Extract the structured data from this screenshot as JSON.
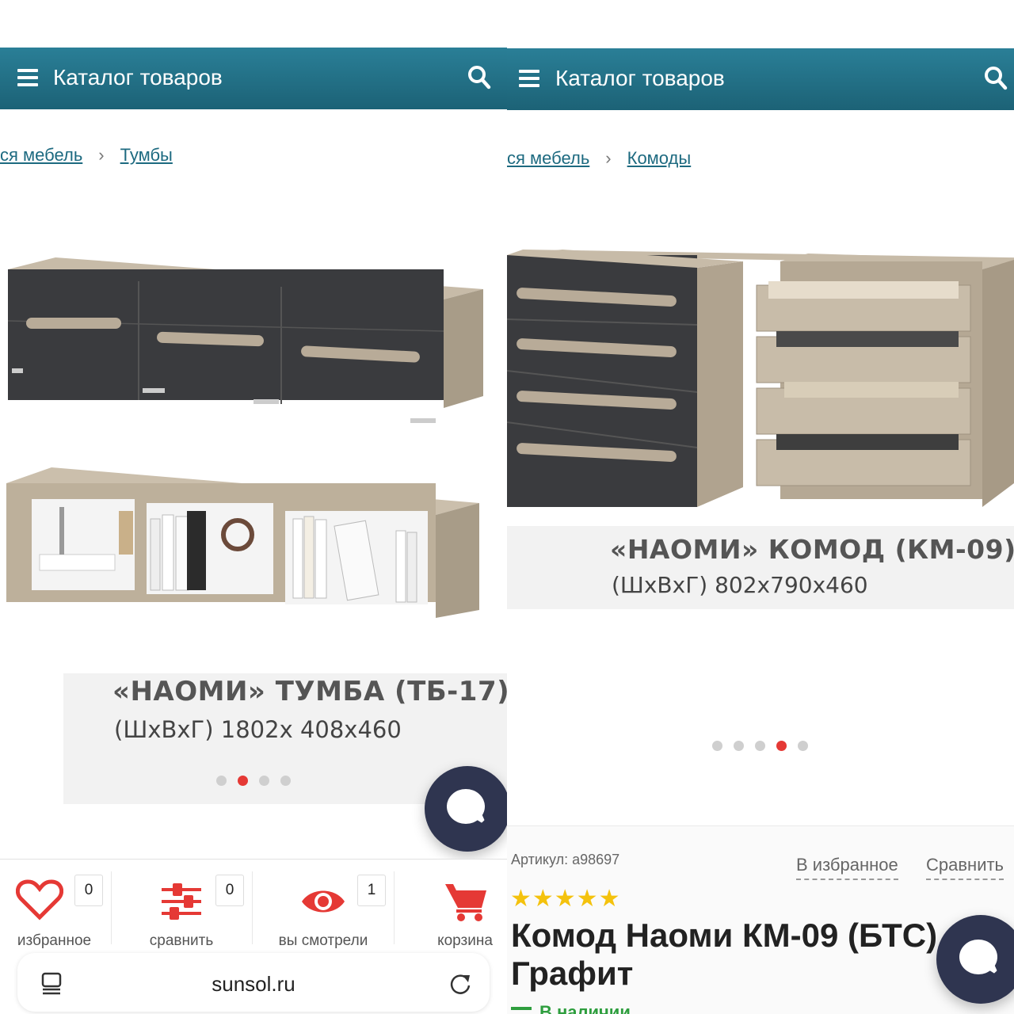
{
  "left": {
    "header": {
      "title": "Каталог товаров",
      "menu_icon": "hamburger-menu-icon",
      "search_icon": "search-icon"
    },
    "breadcrumb": {
      "crumb1": "ся мебель",
      "crumb2": "Тумбы"
    },
    "product_image": {
      "caption_title": "«НАОМИ» ТУМБА (ТБ-17)",
      "caption_size": "(ШхВхГ) 1802х 408х460"
    },
    "carousel": {
      "total": 4,
      "active": 2
    },
    "chat_icon": "chat-bubble-icon",
    "bottom_nav": [
      {
        "label": "избранное",
        "count": "0",
        "icon": "heart-icon"
      },
      {
        "label": "сравнить",
        "count": "0",
        "icon": "sliders-icon"
      },
      {
        "label": "вы смотрели",
        "count": "1",
        "icon": "eye-icon"
      },
      {
        "label": "корзина",
        "icon": "cart-icon"
      }
    ],
    "url_bar": {
      "url": "sunsol.ru",
      "tabs_icon": "tabs-icon",
      "reload_icon": "reload-icon"
    }
  },
  "right": {
    "header": {
      "title": "Каталог товаров",
      "menu_icon": "hamburger-menu-icon",
      "search_icon": "search-icon"
    },
    "breadcrumb": {
      "crumb1": "ся мебель",
      "crumb2": "Комоды"
    },
    "product_image": {
      "caption_title": "«НАОМИ» КОМОД (КМ-09)",
      "caption_size": "(ШхВхГ) 802х790х460"
    },
    "carousel": {
      "total": 5,
      "active": 4
    },
    "product": {
      "sku": "Артикул: a98697",
      "favorite_link": "В избранное",
      "compare_link": "Сравнить",
      "stars": "★★★★★",
      "rating": 5,
      "name": "Комод Наоми КМ-09 (БТС) Графит",
      "stock": "В наличии"
    }
  },
  "colors": {
    "header": "#1f6b80",
    "accent": "#e53935",
    "dark_front": "#3b3d40",
    "wood": "#b8ab98",
    "chat": "#2f3550",
    "stars": "#f4c20d"
  }
}
